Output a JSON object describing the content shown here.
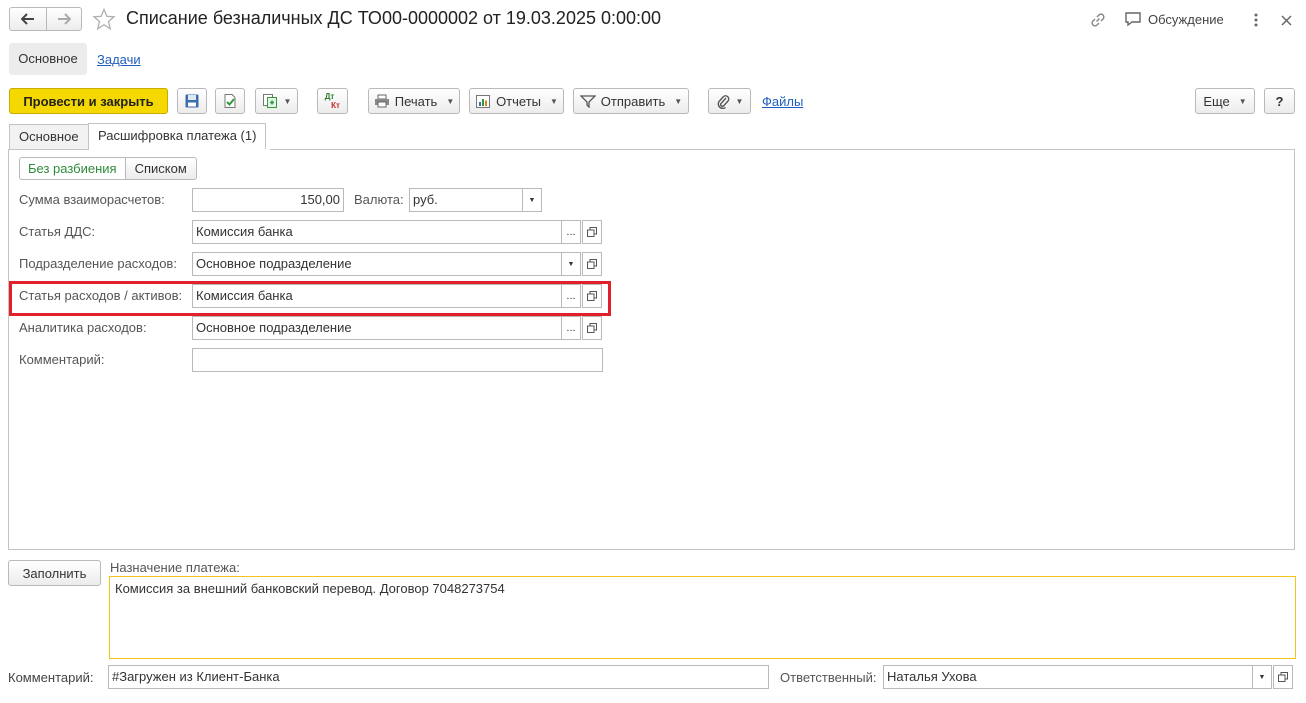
{
  "window": {
    "title": "Списание безналичных ДС ТО00-0000002 от 19.03.2025 0:00:00",
    "discussion_label": "Обсуждение"
  },
  "nav_tabs": {
    "main": "Основное",
    "tasks": "Задачи"
  },
  "toolbar": {
    "post_close": "Провести и закрыть",
    "dt_kt_top": "Дт",
    "dt_kt_bottom": "Кт",
    "print": "Печать",
    "reports": "Отчеты",
    "send": "Отправить",
    "files": "Файлы",
    "more": "Еще",
    "help": "?"
  },
  "form_tabs": {
    "basic": "Основное",
    "decoding": "Расшифровка платежа (1)"
  },
  "mode_switch": {
    "no_split": "Без разбиения",
    "list": "Списком"
  },
  "fields": {
    "sum_label": "Сумма взаиморасчетов:",
    "sum_value": "150,00",
    "currency_label": "Валюта:",
    "currency_value": "руб.",
    "dds_label": "Статья ДДС:",
    "dds_value": "Комиссия банка",
    "dept_label": "Подразделение расходов:",
    "dept_value": "Основное подразделение",
    "expense_label": "Статья расходов / активов:",
    "expense_value": "Комиссия банка",
    "analytics_label": "Аналитика расходов:",
    "analytics_value": "Основное подразделение",
    "comment_label": "Комментарий:",
    "comment_value": ""
  },
  "bottom": {
    "fill_button": "Заполнить",
    "purpose_label": "Назначение платежа:",
    "purpose_value": "Комиссия за внешний банковский перевод. Договор 7048273754",
    "comment_label": "Комментарий:",
    "comment_value": "#Загружен из Клиент-Банка",
    "responsible_label": "Ответственный:",
    "responsible_value": "Наталья Ухова"
  },
  "colors": {
    "accent_yellow": "#f5d800",
    "highlight_red": "#e0202a",
    "link_blue": "#1f5fbf",
    "focus_border": "#f0c419"
  }
}
